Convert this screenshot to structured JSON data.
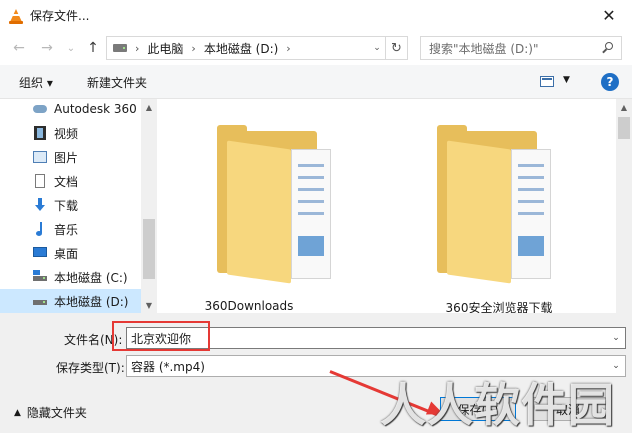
{
  "window": {
    "title": "保存文件...",
    "close_glyph": "✕"
  },
  "nav": {
    "back_glyph": "←",
    "forward_glyph": "→",
    "recent_glyph": "⌄",
    "up_glyph": "↑",
    "breadcrumbs": [
      "此电脑",
      "本地磁盘 (D:)"
    ],
    "breadcrumb_sep": "›",
    "dropdown_glyph": "⌄",
    "refresh_glyph": "↻",
    "search_placeholder": "搜索\"本地磁盘 (D:)\""
  },
  "toolbar": {
    "organize": "组织 ▾",
    "new_folder": "新建文件夹",
    "view_dropdown": "▼",
    "help": "?"
  },
  "sidebar": {
    "items": [
      {
        "label": "Autodesk 360",
        "icon": "cloud-icon"
      },
      {
        "label": "视频",
        "icon": "video-icon"
      },
      {
        "label": "图片",
        "icon": "pictures-icon"
      },
      {
        "label": "文档",
        "icon": "documents-icon"
      },
      {
        "label": "下载",
        "icon": "download-icon"
      },
      {
        "label": "音乐",
        "icon": "music-icon"
      },
      {
        "label": "桌面",
        "icon": "desktop-icon"
      },
      {
        "label": "本地磁盘 (C:)",
        "icon": "drive-c-icon"
      },
      {
        "label": "本地磁盘 (D:)",
        "icon": "drive-d-icon",
        "selected": true
      }
    ],
    "scroll_up": "▲",
    "scroll_down": "▼"
  },
  "content": {
    "folders": [
      "360Downloads",
      "360安全浏览器下载"
    ],
    "scroll_up": "▲"
  },
  "form": {
    "filename_label": "文件名(N):",
    "filename_value": "北京欢迎你",
    "type_label": "保存类型(T):",
    "type_value": "容器 (*.mp4)",
    "dropdown_glyph": "⌄",
    "hide_folders": "隐藏文件夹",
    "hide_caret": "▲",
    "save_button": "保存(S)",
    "cancel_button": "取消"
  },
  "watermark": "人人软件园",
  "colors": {
    "accent": "#0078d7",
    "annotation": "#e53935",
    "selected_bg": "#cce8ff",
    "folder": "#e7be5b"
  }
}
